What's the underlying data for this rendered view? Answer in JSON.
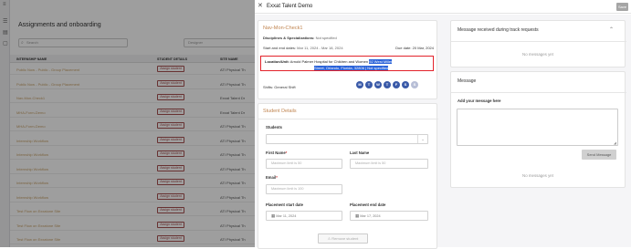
{
  "background": {
    "title": "Assignments and onboarding",
    "search_placeholder": "Search",
    "designer_placeholder": "Designer",
    "columns": [
      "INTERNSHIP NAME",
      "STUDENT DETAILS",
      "SITE NAME"
    ],
    "rows": [
      {
        "name": "Public Now - Public - Group Placement",
        "button": "Assign student",
        "site": "ATI Physical Th"
      },
      {
        "name": "Public Now - Public - Group Placement",
        "button": "Assign student",
        "site": "ATI Physical Th"
      },
      {
        "name": "Nav-Mon-Check1",
        "button": "Assign student",
        "site": "Exxat Talent Dr"
      },
      {
        "name": "MHA-Form-Demo",
        "button": "Assign student",
        "site": "Exxat Talent Dr"
      },
      {
        "name": "MHA-Form-Demo",
        "button": "Assign student",
        "site": "ATI Physical Th"
      },
      {
        "name": "Internship Workflow",
        "button": "Assign student",
        "site": "ATI Physical Th"
      },
      {
        "name": "Internship Workflow",
        "button": "Assign student",
        "site": "ATI Physical Th"
      },
      {
        "name": "Internship Workflow",
        "button": "Assign student",
        "site": "ATI Physical Th"
      },
      {
        "name": "Internship Workflow",
        "button": "Assign student",
        "site": "ATI Physical Th"
      },
      {
        "name": "Internship Workflow",
        "button": "Assign student",
        "site": "ATI Physical Th"
      },
      {
        "name": "Test Flow on Exxatone Site",
        "button": "Assign student",
        "site": "ATI Physical Th"
      },
      {
        "name": "Test Flow on Exxatone Site",
        "button": "Assign student",
        "site": "ATI Physical Th"
      },
      {
        "name": "Test Flow on Exxatone Site",
        "button": "Assign student",
        "site": "ATI Physical Th"
      }
    ]
  },
  "modal": {
    "close_icon": "close-icon",
    "title": "Exxat Talent Demo",
    "save_label": "Save",
    "placement": {
      "title": "Nav-Mon-Check1",
      "disc_label": "Disciplines & Specializations:",
      "disc_value": "Not specified",
      "dates_label": "Start and end dates:",
      "dates_value": "Mar 11, 2024 - Mar 18, 2024",
      "due_label": "Due date:",
      "due_value": "20 Mar, 2024",
      "location_label": "Location/Unit:",
      "location_value": "Arnold Palmer Hospital for Children and Women",
      "location_highlight_1": "92 West Miller",
      "location_highlight_2": "Street, Orlando, Florida, 32806 | Not specified",
      "shifts_label": "Shifts:",
      "shifts_value": "General Shift",
      "days": [
        {
          "letter": "M",
          "active": true
        },
        {
          "letter": "T",
          "active": true
        },
        {
          "letter": "W",
          "active": true
        },
        {
          "letter": "T",
          "active": true
        },
        {
          "letter": "F",
          "active": true
        },
        {
          "letter": "S",
          "active": true
        },
        {
          "letter": "S",
          "active": false
        }
      ]
    },
    "student": {
      "title": "Student Details",
      "students_label": "Students",
      "first_name_label": "First Name",
      "first_name_placeholder": "Maximum limit is 50",
      "last_name_label": "Last Name",
      "last_name_placeholder": "Maximum limit is 50",
      "email_label": "Email",
      "email_placeholder": "Maximum limit is 100",
      "start_label": "Placement start date",
      "start_value": "Mar 11, 2024",
      "end_label": "Placement end date",
      "end_value": "Mar 17, 2024",
      "remove_label": "Remove student"
    },
    "messages_received": {
      "title": "Message received during track requests",
      "empty": "No messages yet"
    },
    "message": {
      "title": "Message",
      "add_label": "Add your message here",
      "send_label": "Send Message",
      "empty": "No messages yet"
    }
  }
}
